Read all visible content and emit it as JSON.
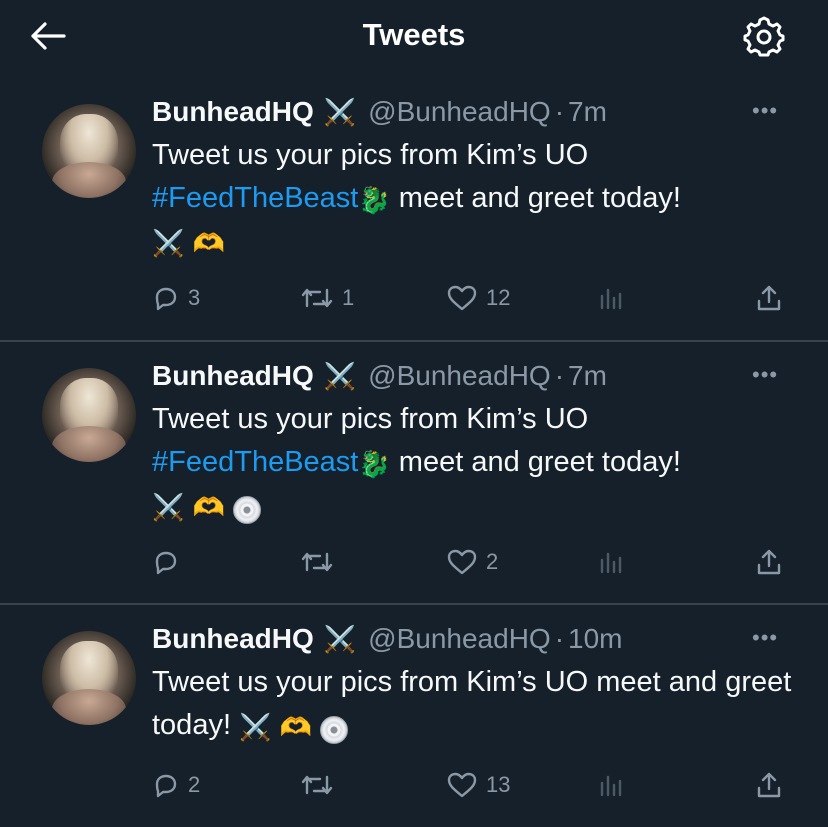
{
  "header": {
    "title": "Tweets",
    "back_icon": "arrow-left-icon",
    "settings_icon": "gear-icon"
  },
  "colors": {
    "background": "#15202b",
    "link": "#1d9bf0",
    "muted": "#8b98a5",
    "divider": "#38444d"
  },
  "tweets": [
    {
      "name": "BunheadHQ",
      "name_badge": "⚔️",
      "handle": "@BunheadHQ",
      "sep": "·",
      "time": "7m",
      "more": "•••",
      "text_part1": "Tweet us your pics from Kim’s UO ",
      "hashtag": "#FeedTheBeast",
      "text_part2": " meet and greet today!",
      "emoji_dragon": "🐉",
      "emoji_swords": "⚔️",
      "emoji_hands": "🫶",
      "emoji_disc": "",
      "reply_count": "3",
      "retweet_count": "1",
      "like_count": "12"
    },
    {
      "name": "BunheadHQ",
      "name_badge": "⚔️",
      "handle": "@BunheadHQ",
      "sep": "·",
      "time": "7m",
      "more": "•••",
      "text_part1": "Tweet us your pics from Kim’s UO ",
      "hashtag": "#FeedTheBeast",
      "text_part2": " meet and greet today!",
      "emoji_dragon": "🐉",
      "emoji_swords": "⚔️",
      "emoji_hands": "🫶",
      "emoji_disc": "💿",
      "reply_count": "",
      "retweet_count": "",
      "like_count": "2"
    },
    {
      "name": "BunheadHQ",
      "name_badge": "⚔️",
      "handle": "@BunheadHQ",
      "sep": "·",
      "time": "10m",
      "more": "•••",
      "text_part1": "Tweet us your pics from Kim’s UO meet and greet today! ",
      "emoji_swords": "⚔️",
      "emoji_hands": "🫶",
      "emoji_disc": "💿",
      "reply_count": "2",
      "retweet_count": "",
      "like_count": "13"
    }
  ]
}
